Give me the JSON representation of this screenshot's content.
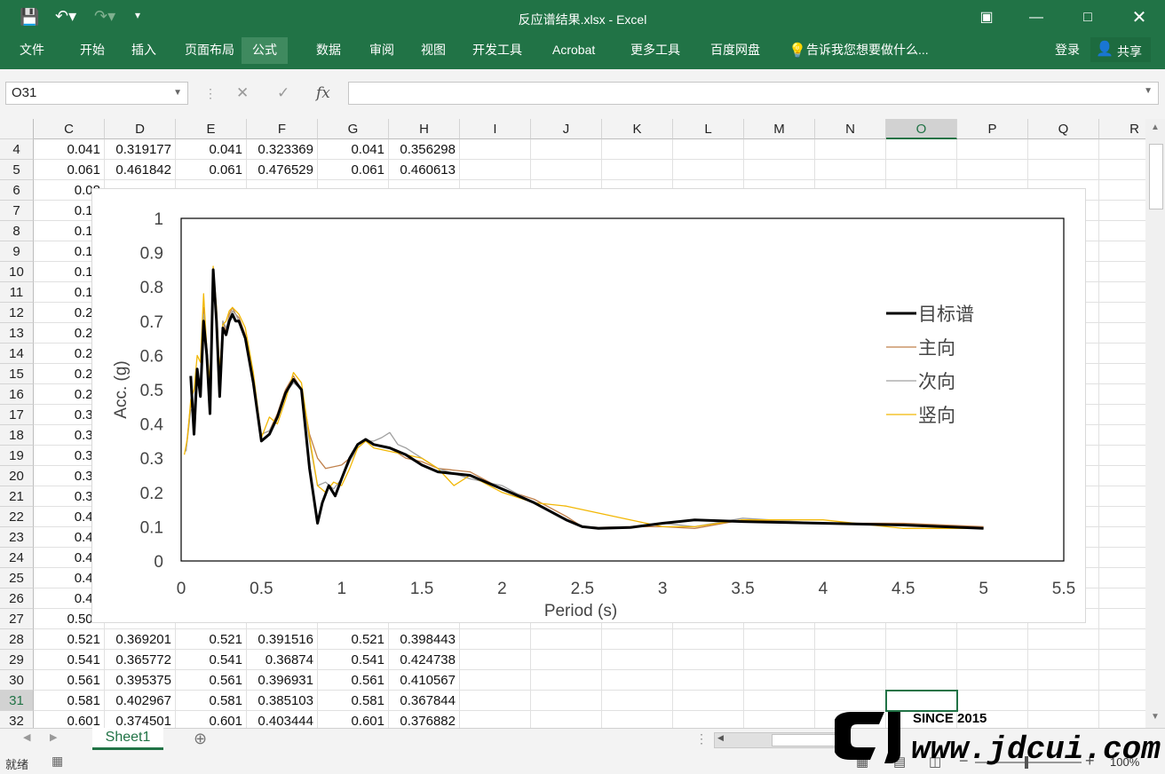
{
  "window": {
    "title": "反应谱结果.xlsx - Excel"
  },
  "ribbon": {
    "tabs": [
      "文件",
      "开始",
      "插入",
      "页面布局",
      "公式",
      "数据",
      "审阅",
      "视图",
      "开发工具",
      "Acrobat",
      "更多工具",
      "百度网盘"
    ],
    "active_tab": "公式",
    "tell_me": "告诉我您想要做什么...",
    "login": "登录",
    "share": "共享"
  },
  "formula_bar": {
    "name_box": "O31",
    "formula": "",
    "fx_label": "fx"
  },
  "columns": [
    "C",
    "D",
    "E",
    "F",
    "G",
    "H",
    "I",
    "J",
    "K",
    "L",
    "M",
    "N",
    "O",
    "P",
    "Q",
    "R"
  ],
  "selected_column": "O",
  "selected_row": 31,
  "rows": [
    {
      "n": 4,
      "c": "0.041",
      "d": "0.319177",
      "e": "0.041",
      "f": "0.323369",
      "g": "0.041",
      "h": "0.356298"
    },
    {
      "n": 5,
      "c": "0.061",
      "d": "0.461842",
      "e": "0.061",
      "f": "0.476529",
      "g": "0.061",
      "h": "0.460613"
    },
    {
      "n": 6,
      "c": "0.08",
      "d": "",
      "e": "",
      "f": "",
      "g": "",
      "h": ""
    },
    {
      "n": 7,
      "c": "0.10",
      "d": "",
      "e": "",
      "f": "",
      "g": "",
      "h": ""
    },
    {
      "n": 8,
      "c": "0.12",
      "d": "",
      "e": "",
      "f": "",
      "g": "",
      "h": ""
    },
    {
      "n": 9,
      "c": "0.14",
      "d": "",
      "e": "",
      "f": "",
      "g": "",
      "h": ""
    },
    {
      "n": 10,
      "c": "0.16",
      "d": "",
      "e": "",
      "f": "",
      "g": "",
      "h": ""
    },
    {
      "n": 11,
      "c": "0.18",
      "d": "",
      "e": "",
      "f": "",
      "g": "",
      "h": ""
    },
    {
      "n": 12,
      "c": "0.20",
      "d": "",
      "e": "",
      "f": "",
      "g": "",
      "h": ""
    },
    {
      "n": 13,
      "c": "0.22",
      "d": "",
      "e": "",
      "f": "",
      "g": "",
      "h": ""
    },
    {
      "n": 14,
      "c": "0.24",
      "d": "",
      "e": "",
      "f": "",
      "g": "",
      "h": ""
    },
    {
      "n": 15,
      "c": "0.26",
      "d": "",
      "e": "",
      "f": "",
      "g": "",
      "h": ""
    },
    {
      "n": 16,
      "c": "0.28",
      "d": "",
      "e": "",
      "f": "",
      "g": "",
      "h": ""
    },
    {
      "n": 17,
      "c": "0.30",
      "d": "",
      "e": "",
      "f": "",
      "g": "",
      "h": ""
    },
    {
      "n": 18,
      "c": "0.32",
      "d": "",
      "e": "",
      "f": "",
      "g": "",
      "h": ""
    },
    {
      "n": 19,
      "c": "0.34",
      "d": "",
      "e": "",
      "f": "",
      "g": "",
      "h": ""
    },
    {
      "n": 20,
      "c": "0.36",
      "d": "",
      "e": "",
      "f": "",
      "g": "",
      "h": ""
    },
    {
      "n": 21,
      "c": "0.38",
      "d": "",
      "e": "",
      "f": "",
      "g": "",
      "h": ""
    },
    {
      "n": 22,
      "c": "0.40",
      "d": "",
      "e": "",
      "f": "",
      "g": "",
      "h": ""
    },
    {
      "n": 23,
      "c": "0.42",
      "d": "",
      "e": "",
      "f": "",
      "g": "",
      "h": ""
    },
    {
      "n": 24,
      "c": "0.44",
      "d": "",
      "e": "",
      "f": "",
      "g": "",
      "h": ""
    },
    {
      "n": 25,
      "c": "0.46",
      "d": "",
      "e": "",
      "f": "",
      "g": "",
      "h": ""
    },
    {
      "n": 26,
      "c": "0.48",
      "d": "",
      "e": "",
      "f": "",
      "g": "",
      "h": ""
    },
    {
      "n": 27,
      "c": "0.501",
      "d": "",
      "e": "",
      "f": "",
      "g": "",
      "h": ""
    },
    {
      "n": 28,
      "c": "0.521",
      "d": "0.369201",
      "e": "0.521",
      "f": "0.391516",
      "g": "0.521",
      "h": "0.398443"
    },
    {
      "n": 29,
      "c": "0.541",
      "d": "0.365772",
      "e": "0.541",
      "f": "0.36874",
      "g": "0.541",
      "h": "0.424738"
    },
    {
      "n": 30,
      "c": "0.561",
      "d": "0.395375",
      "e": "0.561",
      "f": "0.396931",
      "g": "0.561",
      "h": "0.410567"
    },
    {
      "n": 31,
      "c": "0.581",
      "d": "0.402967",
      "e": "0.581",
      "f": "0.385103",
      "g": "0.581",
      "h": "0.367844"
    },
    {
      "n": 32,
      "c": "0.601",
      "d": "0.374501",
      "e": "0.601",
      "f": "0.403444",
      "g": "0.601",
      "h": "0.376882"
    }
  ],
  "chart_data": {
    "type": "line",
    "title": "",
    "xlabel": "Period (s)",
    "ylabel": "Acc. (g)",
    "xlim": [
      0,
      5.5
    ],
    "ylim": [
      0,
      1
    ],
    "xticks": [
      "0",
      "0.5",
      "1",
      "1.5",
      "2",
      "2.5",
      "3",
      "3.5",
      "4",
      "4.5",
      "5",
      "5.5"
    ],
    "yticks": [
      "0",
      "0.1",
      "0.2",
      "0.3",
      "0.4",
      "0.5",
      "0.6",
      "0.7",
      "0.8",
      "0.9",
      "1"
    ],
    "legend_position": "right",
    "series": [
      {
        "name": "目标谱",
        "color": "#000000",
        "x": [
          0.06,
          0.08,
          0.1,
          0.12,
          0.14,
          0.16,
          0.18,
          0.2,
          0.22,
          0.24,
          0.26,
          0.28,
          0.3,
          0.32,
          0.34,
          0.36,
          0.4,
          0.45,
          0.5,
          0.55,
          0.6,
          0.65,
          0.7,
          0.75,
          0.8,
          0.85,
          0.88,
          0.92,
          0.96,
          1.0,
          1.05,
          1.1,
          1.15,
          1.2,
          1.3,
          1.4,
          1.5,
          1.6,
          1.8,
          2.0,
          2.2,
          2.4,
          2.5,
          2.6,
          2.8,
          3.0,
          3.2,
          3.5,
          4.0,
          4.5,
          5.0
        ],
        "y": [
          0.54,
          0.37,
          0.56,
          0.48,
          0.7,
          0.6,
          0.43,
          0.85,
          0.7,
          0.48,
          0.68,
          0.66,
          0.7,
          0.72,
          0.7,
          0.7,
          0.65,
          0.52,
          0.35,
          0.37,
          0.42,
          0.49,
          0.53,
          0.5,
          0.27,
          0.11,
          0.17,
          0.22,
          0.19,
          0.24,
          0.3,
          0.34,
          0.355,
          0.34,
          0.33,
          0.31,
          0.28,
          0.26,
          0.25,
          0.21,
          0.17,
          0.12,
          0.1,
          0.095,
          0.098,
          0.11,
          0.12,
          0.115,
          0.11,
          0.105,
          0.095
        ]
      },
      {
        "name": "主向",
        "color": "#c0804a",
        "x": [
          0.03,
          0.06,
          0.08,
          0.1,
          0.12,
          0.14,
          0.16,
          0.18,
          0.2,
          0.22,
          0.24,
          0.26,
          0.28,
          0.3,
          0.32,
          0.34,
          0.36,
          0.4,
          0.45,
          0.5,
          0.55,
          0.6,
          0.65,
          0.7,
          0.75,
          0.8,
          0.85,
          0.9,
          1.0,
          1.05,
          1.1,
          1.15,
          1.2,
          1.3,
          1.4,
          1.5,
          1.6,
          1.8,
          2.0,
          2.2,
          2.4,
          2.5,
          2.6,
          2.8,
          3.0,
          3.2,
          3.5,
          4.0,
          4.5,
          5.0
        ],
        "y": [
          0.32,
          0.46,
          0.42,
          0.52,
          0.5,
          0.74,
          0.62,
          0.5,
          0.83,
          0.68,
          0.55,
          0.7,
          0.67,
          0.72,
          0.74,
          0.72,
          0.71,
          0.66,
          0.53,
          0.37,
          0.38,
          0.43,
          0.5,
          0.54,
          0.5,
          0.37,
          0.3,
          0.27,
          0.28,
          0.3,
          0.33,
          0.35,
          0.34,
          0.33,
          0.3,
          0.29,
          0.27,
          0.26,
          0.21,
          0.18,
          0.13,
          0.1,
          0.098,
          0.1,
          0.1,
          0.095,
          0.12,
          0.11,
          0.11,
          0.1
        ]
      },
      {
        "name": "次向",
        "color": "#a0a0a0",
        "x": [
          0.03,
          0.06,
          0.08,
          0.1,
          0.12,
          0.14,
          0.16,
          0.18,
          0.2,
          0.22,
          0.24,
          0.26,
          0.28,
          0.3,
          0.32,
          0.34,
          0.36,
          0.4,
          0.45,
          0.5,
          0.55,
          0.6,
          0.65,
          0.7,
          0.75,
          0.8,
          0.85,
          0.9,
          0.95,
          1.0,
          1.05,
          1.1,
          1.15,
          1.2,
          1.25,
          1.3,
          1.35,
          1.4,
          1.5,
          1.6,
          1.8,
          2.0,
          2.2,
          2.4,
          2.5,
          2.6,
          2.8,
          3.0,
          3.2,
          3.5,
          4.0,
          4.5,
          5.0
        ],
        "y": [
          0.32,
          0.44,
          0.45,
          0.55,
          0.52,
          0.72,
          0.6,
          0.48,
          0.82,
          0.7,
          0.52,
          0.7,
          0.68,
          0.71,
          0.73,
          0.72,
          0.7,
          0.65,
          0.52,
          0.37,
          0.38,
          0.42,
          0.49,
          0.52,
          0.5,
          0.35,
          0.22,
          0.23,
          0.21,
          0.24,
          0.29,
          0.33,
          0.35,
          0.35,
          0.36,
          0.375,
          0.34,
          0.33,
          0.3,
          0.27,
          0.24,
          0.22,
          0.17,
          0.12,
          0.1,
          0.098,
          0.1,
          0.11,
          0.1,
          0.125,
          0.11,
          0.105,
          0.095
        ]
      },
      {
        "name": "竖向",
        "color": "#f2b705",
        "x": [
          0.02,
          0.04,
          0.06,
          0.08,
          0.1,
          0.12,
          0.14,
          0.16,
          0.18,
          0.2,
          0.22,
          0.24,
          0.26,
          0.28,
          0.3,
          0.32,
          0.34,
          0.36,
          0.4,
          0.45,
          0.5,
          0.55,
          0.6,
          0.65,
          0.7,
          0.75,
          0.8,
          0.85,
          0.9,
          0.95,
          1.0,
          1.05,
          1.1,
          1.15,
          1.2,
          1.3,
          1.4,
          1.5,
          1.6,
          1.7,
          1.8,
          2.0,
          2.2,
          2.4,
          2.6,
          2.8,
          3.0,
          3.2,
          3.5,
          4.0,
          4.5,
          5.0
        ],
        "y": [
          0.31,
          0.36,
          0.47,
          0.5,
          0.6,
          0.58,
          0.78,
          0.62,
          0.52,
          0.86,
          0.74,
          0.55,
          0.69,
          0.7,
          0.73,
          0.74,
          0.73,
          0.72,
          0.68,
          0.55,
          0.36,
          0.42,
          0.4,
          0.47,
          0.55,
          0.52,
          0.36,
          0.22,
          0.2,
          0.23,
          0.22,
          0.27,
          0.33,
          0.35,
          0.33,
          0.32,
          0.31,
          0.3,
          0.27,
          0.22,
          0.25,
          0.2,
          0.17,
          0.16,
          0.14,
          0.12,
          0.1,
          0.1,
          0.12,
          0.12,
          0.095,
          0.095
        ]
      }
    ]
  },
  "sheets": [
    "Sheet1"
  ],
  "status": {
    "ready": "就绪",
    "zoom": "100%"
  },
  "watermark": {
    "text": "www.jdcui.com",
    "since": "SINCE 2015"
  }
}
